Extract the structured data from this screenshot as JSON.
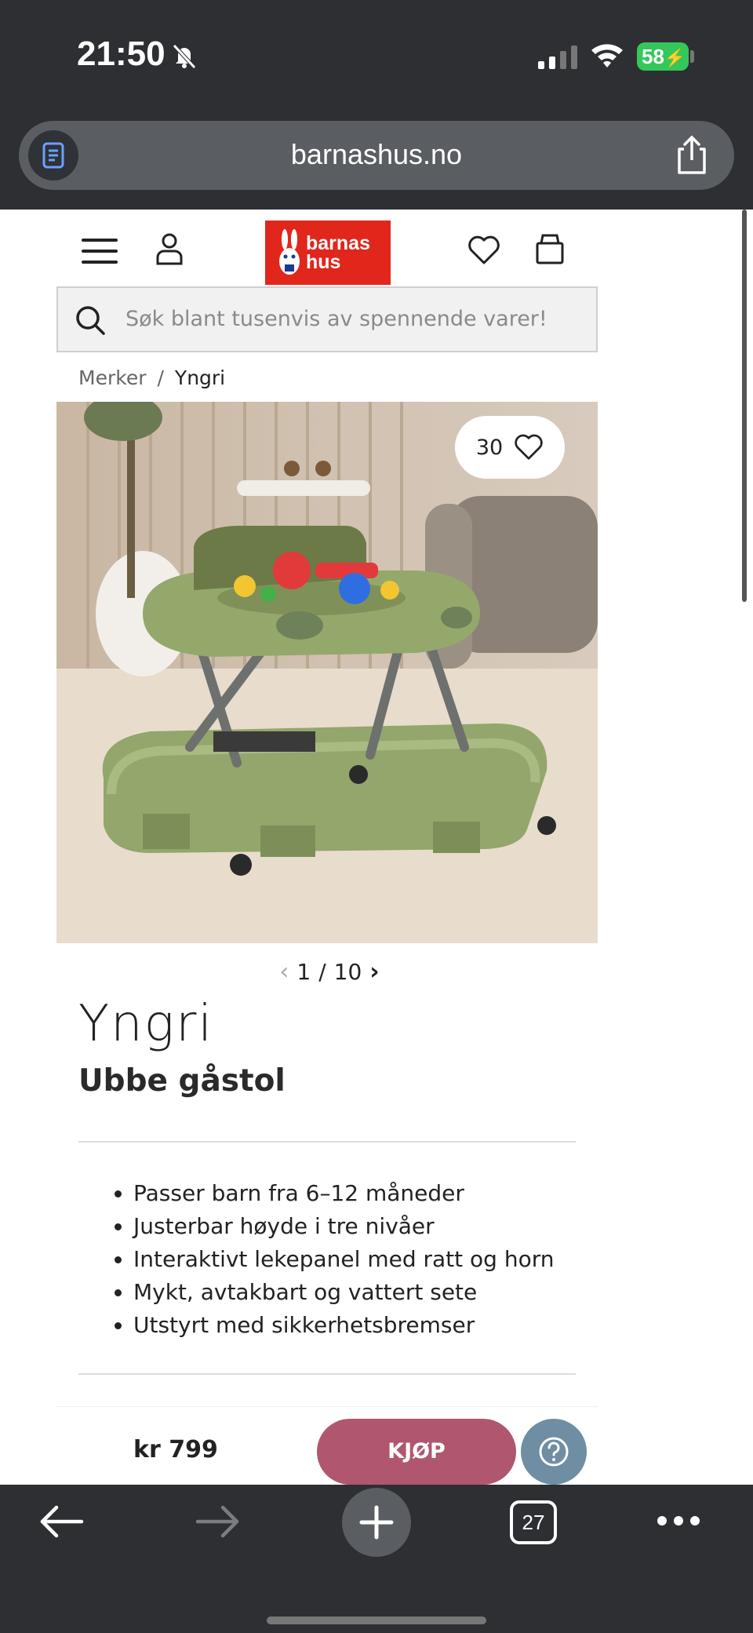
{
  "status": {
    "time": "21:50",
    "battery": "58"
  },
  "browser": {
    "url": "barnashus.no",
    "tabs_count": "27"
  },
  "header": {
    "logo_text": "barnas\nhus"
  },
  "search": {
    "placeholder": "Søk blant tusenvis av spennende varer!"
  },
  "breadcrumb": {
    "items": [
      "Merker",
      "Yngri"
    ],
    "separator": "/"
  },
  "gallery": {
    "favorites_count": "30",
    "current": "1",
    "separator": "/",
    "total": "10"
  },
  "product": {
    "brand": "Yngri",
    "title": "Ubbe gåstol",
    "features": [
      "Passer barn fra 6–12 måneder",
      "Justerbar høyde i tre nivåer",
      "Interaktivt lekepanel med ratt og horn",
      "Mykt, avtakbart og vattert sete",
      "Utstyrt med sikkerhetsbremser"
    ],
    "price": "kr 799",
    "buy_label": "KJØP"
  },
  "colors": {
    "logo_red": "#e1261c",
    "buy_button": "#b0576f",
    "help_button": "#6f8ea3",
    "chrome": "#2d2f32",
    "product_green": "#8fa268"
  }
}
